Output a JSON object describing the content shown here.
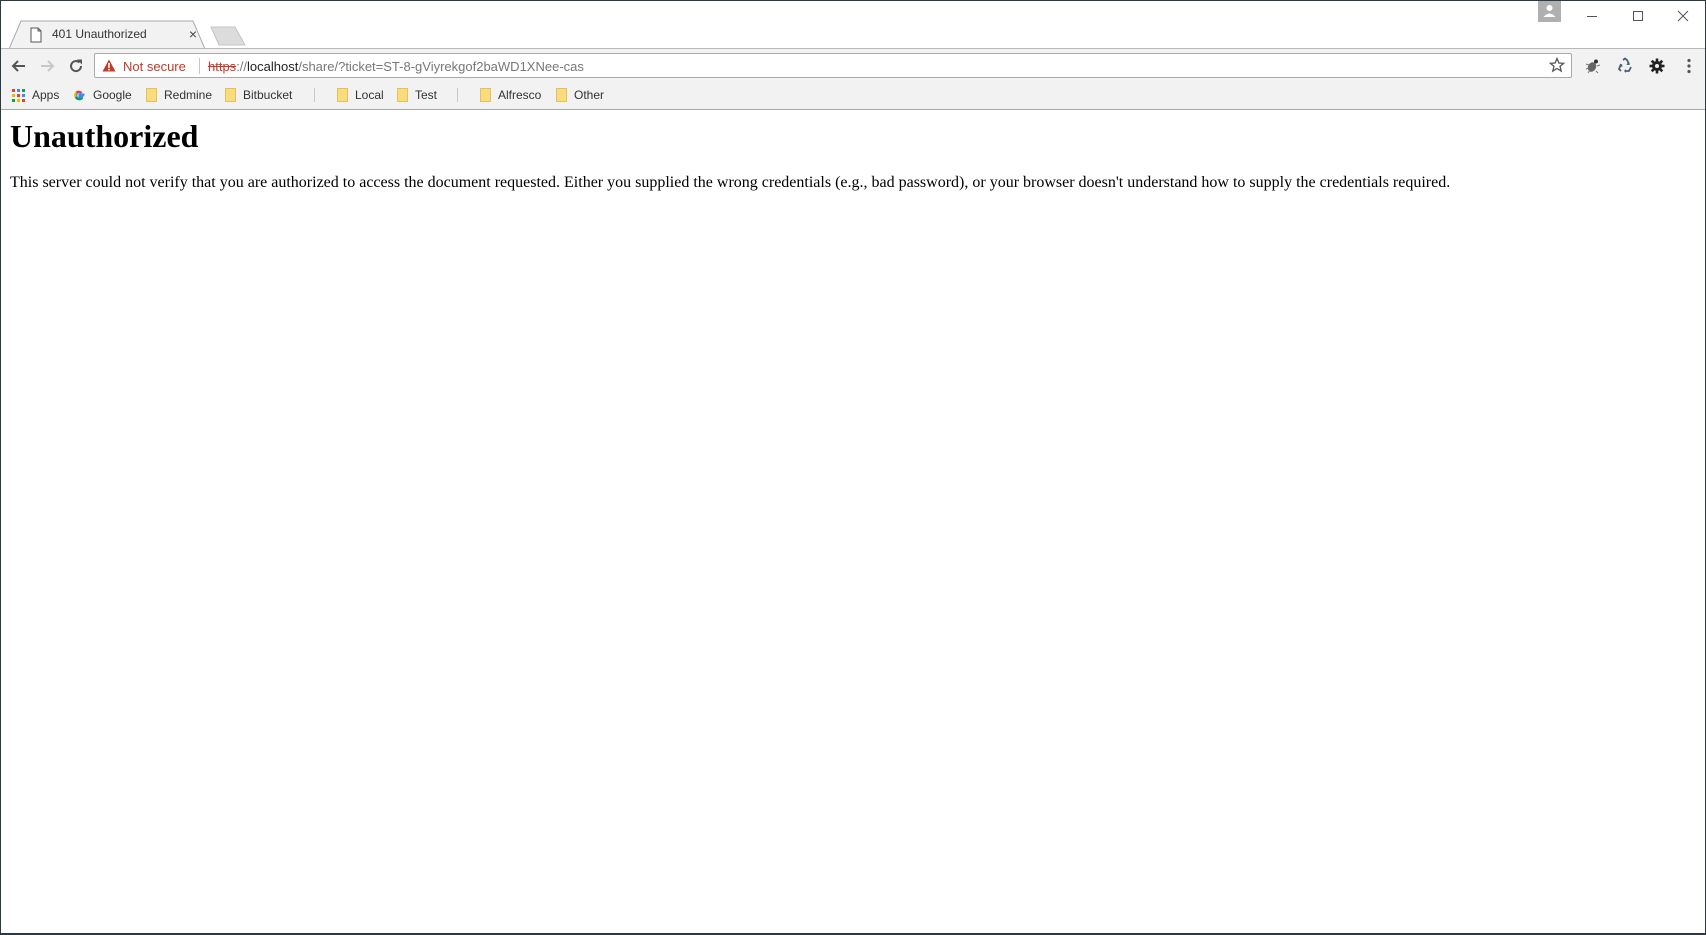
{
  "tab": {
    "title": "401 Unauthorized",
    "close_label": "×"
  },
  "toolbar": {
    "security_label": "Not secure",
    "url": {
      "scheme": "https",
      "separator": "://",
      "host": "localhost",
      "path": "/share/?ticket=ST-8-gViyrekgof2baWD1XNee-cas"
    }
  },
  "bookmarks": [
    {
      "label": "Apps",
      "icon": "apps-grid-icon"
    },
    {
      "label": "Google",
      "icon": "google-icon"
    },
    {
      "label": "Redmine",
      "icon": "folder-icon"
    },
    {
      "label": "Bitbucket",
      "icon": "folder-icon"
    },
    {
      "label": "Local",
      "icon": "folder-icon"
    },
    {
      "label": "Test",
      "icon": "folder-icon"
    },
    {
      "label": "Alfresco",
      "icon": "folder-icon"
    },
    {
      "label": "Other",
      "icon": "folder-icon"
    }
  ],
  "page": {
    "heading": "Unauthorized",
    "message": "This server could not verify that you are authorized to access the document requested. Either you supplied the wrong credentials (e.g., bad password), or your browser doesn't understand how to supply the credentials required."
  },
  "colors": {
    "warning_red": "#c53929",
    "toolbar_bg": "#f2f2f2",
    "folder_yellow": "#f9dc7e"
  }
}
